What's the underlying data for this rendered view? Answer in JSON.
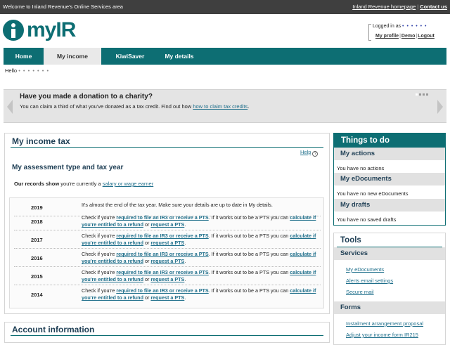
{
  "topbar": {
    "welcome": "Welcome to Inland Revenue's Online Services area",
    "homepage_link": "Inland Revenue homepage",
    "separator": "|",
    "contact_link": "Contact us"
  },
  "logo": {
    "text": "myIR"
  },
  "login": {
    "logged_in_as": "Logged in as",
    "username_masked": "• • • • • •",
    "my_profile": "My profile",
    "demo": "Demo",
    "logout": "Logout",
    "separator": "|"
  },
  "nav": {
    "items": [
      {
        "label": "Home"
      },
      {
        "label": "My income"
      },
      {
        "label": "KiwiSaver"
      },
      {
        "label": "My details"
      }
    ]
  },
  "hello": {
    "label": "Hello",
    "name_masked": "• • • • • • •"
  },
  "banner": {
    "title": "Have you made a donation to a charity?",
    "text": "You can claim a third of what you've donated as a tax credit. Find out how",
    "link": "how to claim tax credits",
    "suffix": "."
  },
  "income_tax": {
    "title": "My income tax",
    "help": "Help",
    "help_icon": "?",
    "subtitle": "My assessment type and tax year",
    "records_bold": "Our records show",
    "records_text": "you're currently a",
    "records_link": "salary or wage earner",
    "years": [
      {
        "year": "2019",
        "text": "It's almost the end of the tax year. Make sure your details are up to date in My details."
      },
      {
        "year": "2018",
        "pre": "Check if you're",
        "link1": "required to file an IR3 or receive a PTS",
        "mid": ". If it works out to be a PTS you can",
        "link2": "calculate if you're entitled to a refund",
        "or": "or",
        "link3": "request a PTS",
        "end": "."
      },
      {
        "year": "2017",
        "pre": "Check if you're",
        "link1": "required to file an IR3 or receive a PTS",
        "mid": ". If it works out to be a PTS you can",
        "link2": "calculate if you're entitled to a refund",
        "or": "or",
        "link3": "request a PTS",
        "end": "."
      },
      {
        "year": "2016",
        "pre": "Check if you're",
        "link1": "required to file an IR3 or receive a PTS",
        "mid": ". If it works out to be a PTS you can",
        "link2": "calculate if you're entitled to a refund",
        "or": "or",
        "link3": "request a PTS",
        "end": "."
      },
      {
        "year": "2015",
        "pre": "Check if you're",
        "link1": "required to file an IR3 or receive a PTS",
        "mid": ". If it works out to be a PTS you can",
        "link2": "calculate if you're entitled to a refund",
        "or": "or",
        "link3": "request a PTS",
        "end": "."
      },
      {
        "year": "2014",
        "pre": "Check if you're",
        "link1": "required to file an IR3 or receive a PTS",
        "mid": ". If it works out to be a PTS you can",
        "link2": "calculate if you're entitled to a refund",
        "or": "or",
        "link3": "request a PTS",
        "end": "."
      }
    ]
  },
  "account_info": {
    "title": "Account information"
  },
  "todo": {
    "title": "Things to do",
    "actions_title": "My actions",
    "actions_msg": "You have no actions",
    "edocs_title": "My eDocuments",
    "edocs_msg": "You have no new eDocuments",
    "drafts_title": "My drafts",
    "drafts_msg": "You have no saved drafts"
  },
  "tools": {
    "title": "Tools",
    "services_title": "Services",
    "services": [
      "My eDocuments",
      "Alerts email settings",
      "Secure mail"
    ],
    "forms_title": "Forms",
    "forms": [
      "Instalment arrangement proposal",
      "Adjust your income form IR215"
    ]
  },
  "colors": {
    "brand": "#0d6e73",
    "link": "#1f6f8b",
    "topbar": "#3f3f3f"
  }
}
